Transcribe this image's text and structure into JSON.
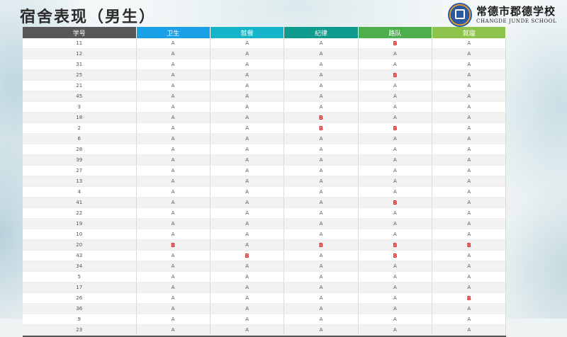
{
  "title": "宿舍表现（男生）",
  "logo": {
    "cn": "常德市郡德学校",
    "en": "CHANGDE JUNDE SCHOOL"
  },
  "colors": {
    "header_id": "#575757",
    "header_weisheng": "#1aa0e6",
    "header_jiucan": "#14b5c9",
    "header_jilv": "#0f9c8e",
    "header_ludui": "#4cae4c",
    "header_jiuqin": "#8cc34a",
    "grade_b": "#e02020"
  },
  "table": {
    "headers": [
      "学号",
      "卫生",
      "就餐",
      "纪律",
      "路队",
      "就寝"
    ],
    "rows": [
      [
        "11",
        "A",
        "A",
        "A",
        "B",
        "A"
      ],
      [
        "12",
        "A",
        "A",
        "A",
        "A",
        "A"
      ],
      [
        "31",
        "A",
        "A",
        "A",
        "A",
        "A"
      ],
      [
        "25",
        "A",
        "A",
        "A",
        "B",
        "A"
      ],
      [
        "21",
        "A",
        "A",
        "A",
        "A",
        "A"
      ],
      [
        "45",
        "A",
        "A",
        "A",
        "A",
        "A"
      ],
      [
        "3",
        "A",
        "A",
        "A",
        "A",
        "A"
      ],
      [
        "18",
        "A",
        "A",
        "B",
        "A",
        "A"
      ],
      [
        "2",
        "A",
        "A",
        "B",
        "B",
        "A"
      ],
      [
        "6",
        "A",
        "A",
        "A",
        "A",
        "A"
      ],
      [
        "28",
        "A",
        "A",
        "A",
        "A",
        "A"
      ],
      [
        "39",
        "A",
        "A",
        "A",
        "A",
        "A"
      ],
      [
        "27",
        "A",
        "A",
        "A",
        "A",
        "A"
      ],
      [
        "13",
        "A",
        "A",
        "A",
        "A",
        "A"
      ],
      [
        "4",
        "A",
        "A",
        "A",
        "A",
        "A"
      ],
      [
        "41",
        "A",
        "A",
        "A",
        "B",
        "A"
      ],
      [
        "22",
        "A",
        "A",
        "A",
        "A",
        "A"
      ],
      [
        "19",
        "A",
        "A",
        "A",
        "A",
        "A"
      ],
      [
        "10",
        "A",
        "A",
        "A",
        "A",
        "A"
      ],
      [
        "20",
        "B",
        "A",
        "B",
        "B",
        "B"
      ],
      [
        "43",
        "A",
        "B",
        "A",
        "B",
        "A"
      ],
      [
        "34",
        "A",
        "A",
        "A",
        "A",
        "A"
      ],
      [
        "5",
        "A",
        "A",
        "A",
        "A",
        "A"
      ],
      [
        "17",
        "A",
        "A",
        "A",
        "A",
        "A"
      ],
      [
        "26",
        "A",
        "A",
        "A",
        "A",
        "B"
      ],
      [
        "36",
        "A",
        "A",
        "A",
        "A",
        "A"
      ],
      [
        "9",
        "A",
        "A",
        "A",
        "A",
        "A"
      ],
      [
        "23",
        "A",
        "A",
        "A",
        "A",
        "A"
      ]
    ]
  }
}
